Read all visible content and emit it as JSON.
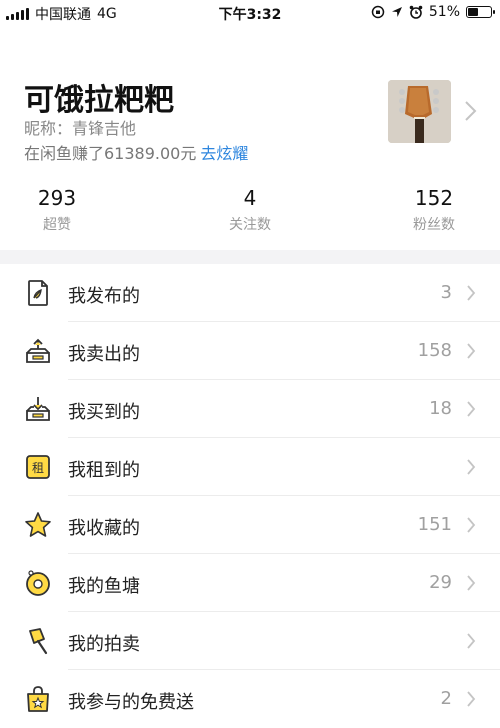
{
  "status_bar": {
    "carrier": "中国联通",
    "network": "4G",
    "time": "下午3:32",
    "battery": "51%",
    "battery_level": 0.51
  },
  "profile": {
    "username": "可饿拉粑粑",
    "nickname": "昵称：青锋吉他",
    "earned": "在闲鱼赚了61389.00元",
    "show_off_link": "去炫耀"
  },
  "stats": [
    {
      "value": "293",
      "label": "超赞"
    },
    {
      "value": "4",
      "label": "关注数"
    },
    {
      "value": "152",
      "label": "粉丝数"
    }
  ],
  "menu": [
    {
      "label": "我发布的",
      "count": "3",
      "icon": "published-doc-icon"
    },
    {
      "label": "我卖出的",
      "count": "158",
      "icon": "sold-box-icon"
    },
    {
      "label": "我买到的",
      "count": "18",
      "icon": "bought-box-icon"
    },
    {
      "label": "我租到的",
      "count": "",
      "icon": "rent-icon"
    },
    {
      "label": "我收藏的",
      "count": "151",
      "icon": "star-icon"
    },
    {
      "label": "我的鱼塘",
      "count": "29",
      "icon": "fish-pond-icon"
    },
    {
      "label": "我的拍卖",
      "count": "",
      "icon": "auction-gavel-icon"
    },
    {
      "label": "我参与的免费送",
      "count": "2",
      "icon": "free-gift-bag-icon"
    }
  ],
  "colors": {
    "accent_yellow": "#FFDA44",
    "link_blue": "#2E86DE"
  }
}
